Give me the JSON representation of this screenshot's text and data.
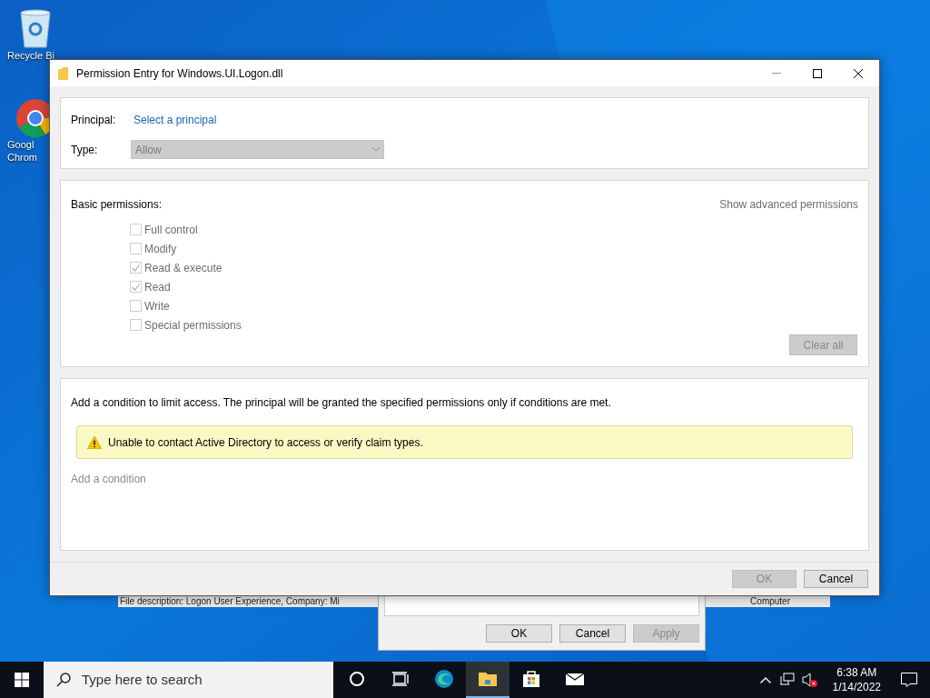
{
  "desktop_icons": [
    {
      "kind": "recycle",
      "label_lines": [
        "Recycle Bi"
      ]
    },
    {
      "kind": "chrome",
      "label_lines": [
        "Googl",
        "Chrom"
      ]
    }
  ],
  "background_window": {
    "status_text": "File description: Logon User Experience, Company: Mi",
    "status_text_right": "Computer"
  },
  "background_dialog": {
    "buttons": [
      {
        "label": "OK",
        "disabled": false
      },
      {
        "label": "Cancel",
        "disabled": false
      },
      {
        "label": "Apply",
        "disabled": true
      }
    ]
  },
  "dialog": {
    "title": "Permission Entry for Windows.UI.Logon.dll",
    "principal": {
      "label": "Principal:",
      "link": "Select a principal"
    },
    "type": {
      "label": "Type:",
      "value": "Allow",
      "disabled": true
    },
    "basic_permissions": {
      "heading": "Basic permissions:",
      "advanced_link": "Show advanced permissions",
      "permissions": [
        {
          "label": "Full control",
          "checked": false,
          "disabled": true
        },
        {
          "label": "Modify",
          "checked": false,
          "disabled": true
        },
        {
          "label": "Read & execute",
          "checked": true,
          "disabled": true
        },
        {
          "label": "Read",
          "checked": true,
          "disabled": true
        },
        {
          "label": "Write",
          "checked": false,
          "disabled": true
        },
        {
          "label": "Special permissions",
          "checked": false,
          "disabled": true
        }
      ],
      "clear_button": {
        "label": "Clear all",
        "disabled": true
      }
    },
    "conditions": {
      "description": "Add a condition to limit access. The principal will be granted the specified permissions only if conditions are met.",
      "warning": "Unable to contact Active Directory to access or verify claim types.",
      "add_link": {
        "label": "Add a condition",
        "disabled": true
      }
    },
    "buttons": [
      {
        "label": "OK",
        "disabled": true
      },
      {
        "label": "Cancel",
        "disabled": false
      }
    ]
  },
  "taskbar": {
    "search_placeholder": "Type here to search",
    "apps": [
      {
        "kind": "cortana",
        "selected": false
      },
      {
        "kind": "taskview",
        "selected": false
      },
      {
        "kind": "edge",
        "selected": false
      },
      {
        "kind": "explorer",
        "selected": true
      },
      {
        "kind": "store",
        "selected": false
      },
      {
        "kind": "mail",
        "selected": false
      }
    ],
    "time": "6:38 AM",
    "date": "1/14/2022"
  }
}
